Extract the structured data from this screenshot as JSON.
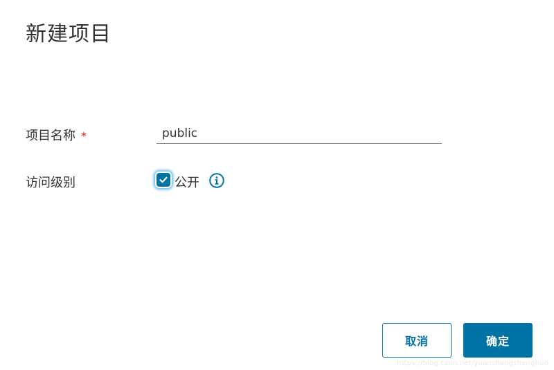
{
  "dialog": {
    "title": "新建项目"
  },
  "form": {
    "name_label": "项目名称",
    "required_mark": "*",
    "name_value": "public",
    "access_label": "访问级别",
    "public_label": "公开",
    "public_checked": true
  },
  "buttons": {
    "cancel_label": "取消",
    "ok_label": "确定"
  },
  "icons": {
    "checkbox": "checkmark-icon",
    "info": "info-circle-icon"
  },
  "colors": {
    "primary": "#0072a3",
    "required": "#c92100",
    "text": "#313131"
  },
  "watermark": "https://blog.csdn.net/yuanshangshenghuo"
}
